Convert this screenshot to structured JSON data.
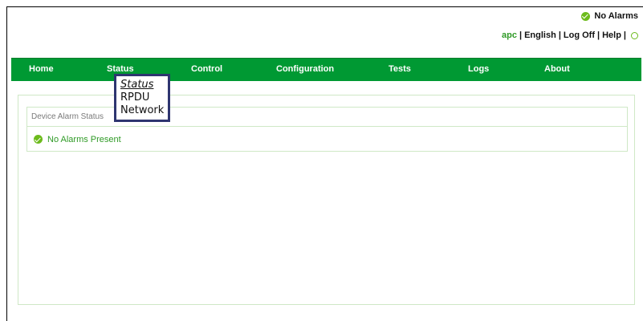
{
  "alarm_status": {
    "label": "No Alarms"
  },
  "userbar": {
    "user": "apc",
    "language": "English",
    "logoff": "Log Off",
    "help": "Help",
    "separator": "|"
  },
  "nav": {
    "home": "Home",
    "status": "Status",
    "control": "Control",
    "configuration": "Configuration",
    "tests": "Tests",
    "logs": "Logs",
    "about": "About"
  },
  "status_menu": {
    "items": [
      "Status",
      "RPDU",
      "Network"
    ],
    "active": "Status"
  },
  "device_alarm_status": {
    "header": "Device Alarm Status",
    "message": "No Alarms Present"
  },
  "colors": {
    "nav_green": "#009933",
    "ok_green": "#6dbb1d",
    "text_green": "#2f9a26",
    "dropdown_border": "#2e3570"
  }
}
